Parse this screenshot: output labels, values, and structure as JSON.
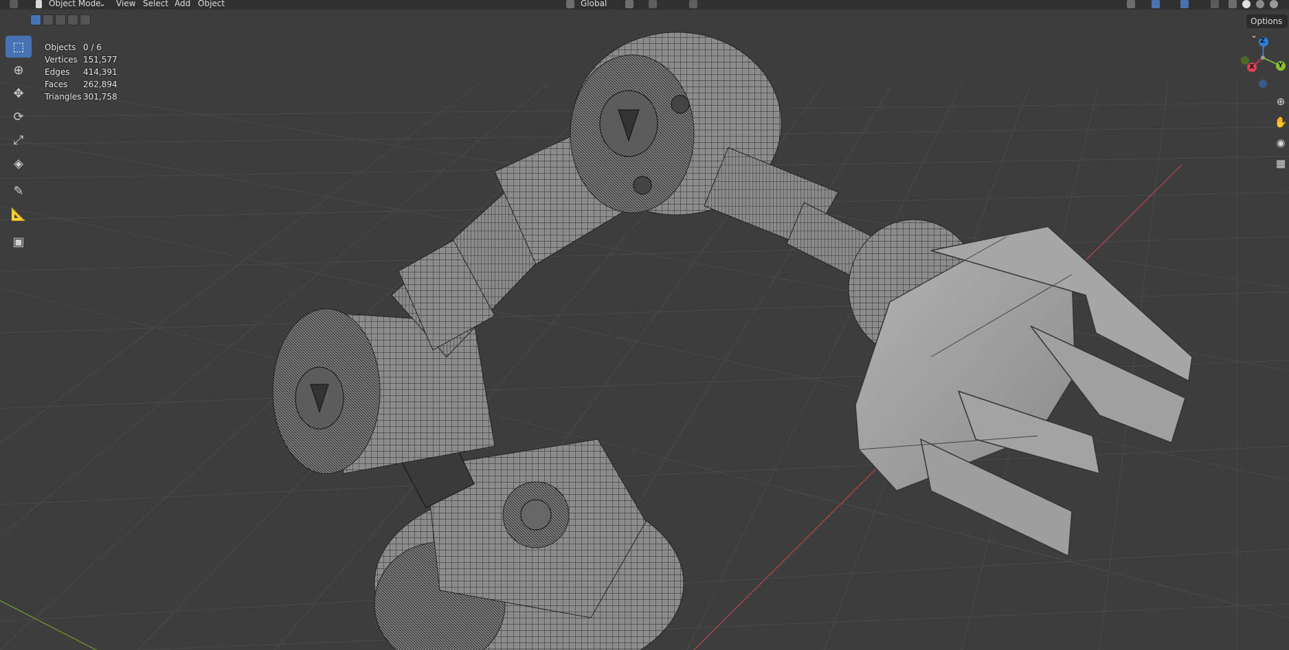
{
  "header": {
    "mode_label": "Object Mode",
    "menu": [
      "View",
      "Select",
      "Add",
      "Object"
    ],
    "transform_orientation": "Global"
  },
  "toolbar": {
    "tools": [
      "select-box",
      "cursor",
      "move",
      "rotate",
      "scale",
      "transform",
      "annotate",
      "measure",
      "add-cube"
    ],
    "active_tool": "select-box"
  },
  "stats": {
    "rows": [
      {
        "label": "Objects",
        "value": "0 / 6"
      },
      {
        "label": "Vertices",
        "value": "151,577"
      },
      {
        "label": "Edges",
        "value": "414,391"
      },
      {
        "label": "Faces",
        "value": "262,894"
      },
      {
        "label": "Triangles",
        "value": "301,758"
      }
    ]
  },
  "options_label": "Options",
  "gizmo": {
    "x": "X",
    "y": "Y",
    "z": "Z"
  },
  "colors": {
    "background": "#3d3d3d",
    "grid": "#4a4a4a",
    "x_axis": "#b8424e",
    "y_axis": "#6f9a2c",
    "accent": "#4772b3",
    "mesh_fill": "#8e8e8e",
    "mesh_wire": "#1e1e1e"
  }
}
